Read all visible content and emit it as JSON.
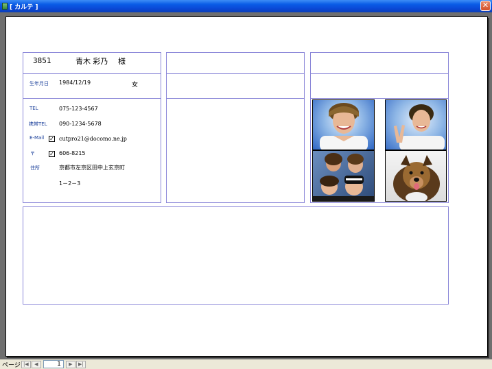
{
  "window": {
    "title": "[ カルテ ]"
  },
  "record": {
    "id": "3851",
    "name": "青木 彩乃",
    "honorific": "様",
    "birth_label": "生年月日",
    "birth_date": "1984/12/19",
    "gender": "女",
    "tel_label": "TEL",
    "tel": "075-123-4567",
    "mobile_label": "携帯TEL",
    "mobile": "090-1234-5678",
    "email_label": "E-Mail",
    "email_checked": true,
    "email": "cutpro21@docomo.ne.jp",
    "zip_label": "〒",
    "zip_checked": true,
    "zip": "606-8215",
    "address_label": "住所",
    "address1": "京都市左京区田中上玄京町",
    "address2": "1－2－3"
  },
  "checkbox_mark": "✓",
  "statusbar": {
    "page_label": "ページ",
    "page_number": "1",
    "nav_first": "|◀",
    "nav_prev": "◀",
    "nav_next": "▶",
    "nav_last": "▶|"
  },
  "colors": {
    "frame": "#6f6f6f",
    "border": "#8a86d8",
    "label": "#1a3f9a"
  }
}
